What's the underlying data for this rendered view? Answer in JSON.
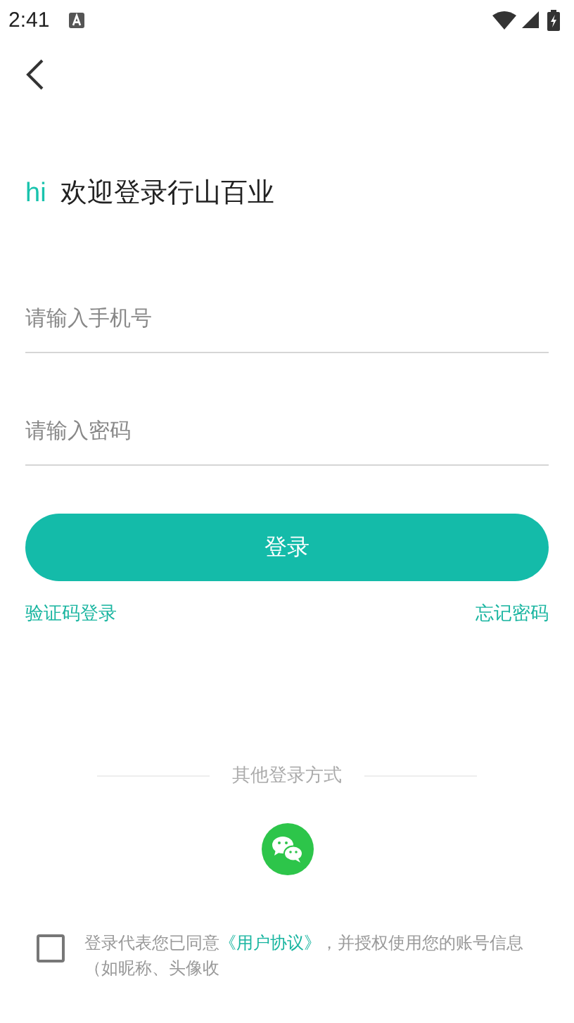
{
  "status_bar": {
    "time": "2:41"
  },
  "greeting": {
    "hi": "hi",
    "title": "欢迎登录行山百业"
  },
  "fields": [
    {
      "placeholder": "请输入手机号"
    },
    {
      "placeholder": "请输入密码"
    }
  ],
  "login_button": "登录",
  "links": [
    "验证码登录",
    "忘记密码"
  ],
  "other_login": {
    "label": "其他登录方式"
  },
  "agreement": {
    "checked": false,
    "before": "登录代表您已同意",
    "link": "《用户协议》",
    "after": "，并授权使用您的账号信息",
    "line2": "（如昵称、头像收"
  }
}
